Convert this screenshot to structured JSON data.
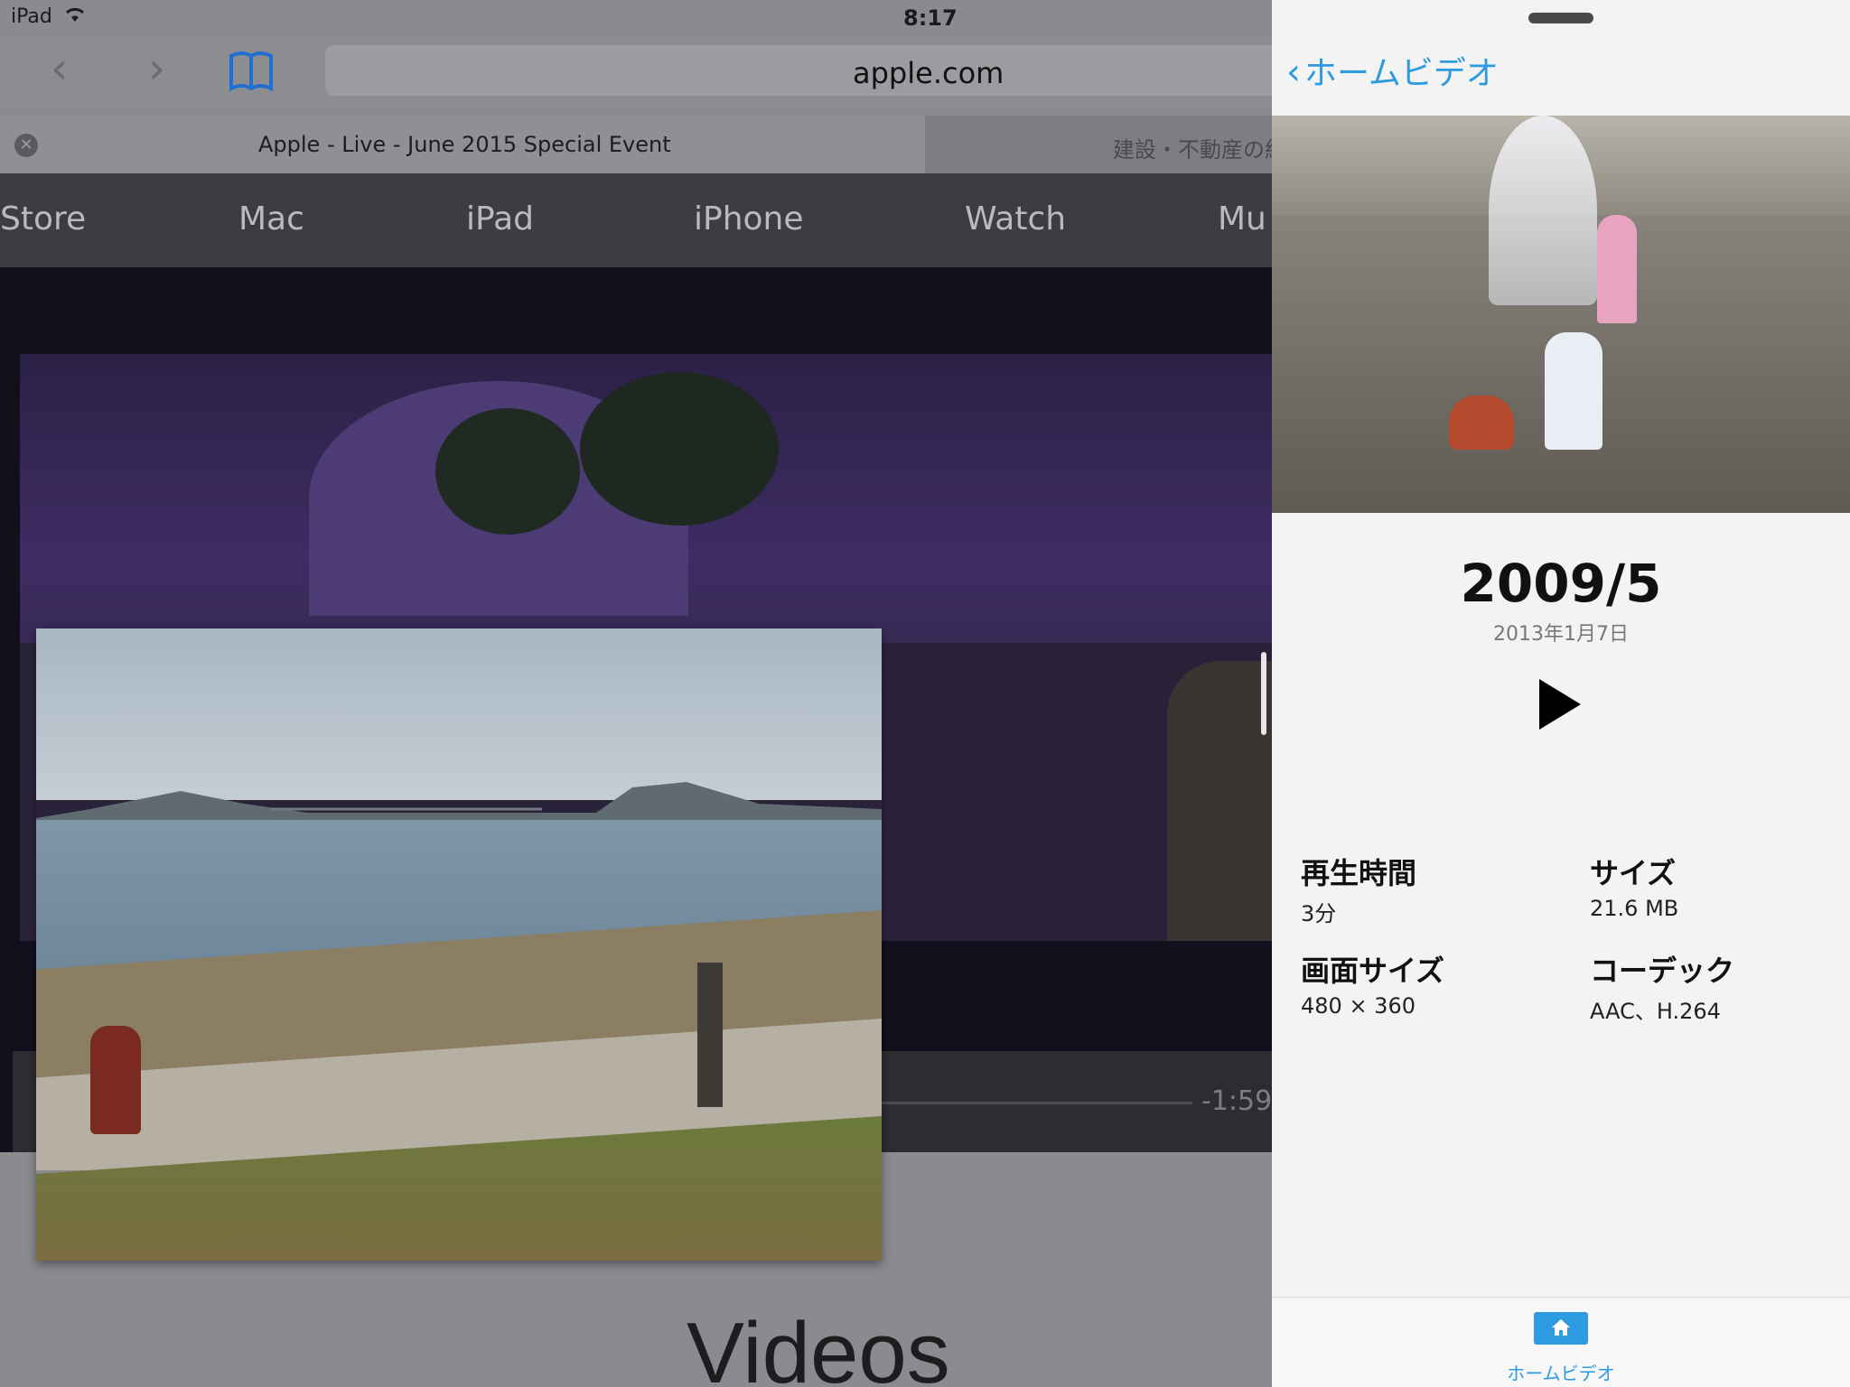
{
  "status_bar": {
    "device": "iPad",
    "time": "8:17"
  },
  "safari": {
    "back_glyph": "‹",
    "forward_glyph": "›",
    "address": "apple.com",
    "tabs": [
      {
        "title": "Apple - Live - June 2015 Special Event"
      },
      {
        "title": "建設・不動産の紅"
      }
    ],
    "apple_nav": [
      "Store",
      "Mac",
      "iPad",
      "iPhone",
      "Watch",
      "Mu"
    ],
    "video_remaining": "-1:59",
    "section_heading": "Videos"
  },
  "detail": {
    "back_label": "ホームビデオ",
    "title": "2009/5",
    "subtitle": "2013年1月7日",
    "info": [
      {
        "label": "再生時間",
        "value": "3分"
      },
      {
        "label": "サイズ",
        "value": "21.6 MB"
      },
      {
        "label": "画面サイズ",
        "value": "480 × 360"
      },
      {
        "label": "コーデック",
        "value": "AAC、H.264"
      }
    ],
    "tab_label": "ホームビデオ"
  },
  "colors": {
    "accent": "#2e9ae0"
  }
}
